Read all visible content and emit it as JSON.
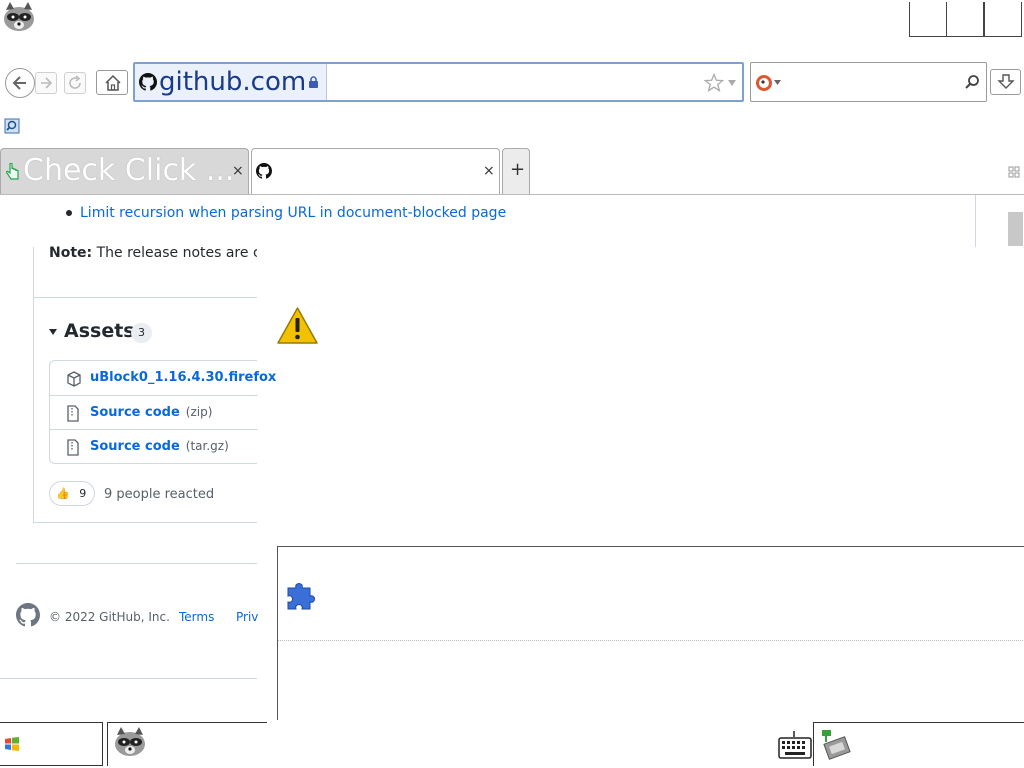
{
  "browser": {
    "address": {
      "domain": "github.com"
    },
    "tabs": [
      {
        "title": "Check Click ...",
        "close": "×"
      },
      {
        "title": "",
        "close": "×"
      }
    ],
    "new_tab": "+"
  },
  "page": {
    "bullet": "Limit recursion when parsing URL in document-blocked page",
    "note_label": "Note:",
    "note_text": "The release notes are cr",
    "assets": {
      "title": "Assets",
      "count": "3",
      "items": [
        {
          "name": "uBlock0_1.16.4.30.firefox",
          "ext": ""
        },
        {
          "name": "Source code",
          "ext": "(zip)"
        },
        {
          "name": "Source code",
          "ext": "(tar.gz)"
        }
      ]
    },
    "reactions": {
      "emoji": "👍",
      "count": "9",
      "text": "9 people reacted"
    },
    "footer": {
      "copyright": "© 2022 GitHub, Inc.",
      "terms": "Terms",
      "privacy": "Priv"
    }
  },
  "colors": {
    "link": "#0969da",
    "url_text": "#1a3a8a",
    "plugin_blue": "#3a6fd8",
    "warning": "#f2c200"
  },
  "icons": [
    "raccoon-app-icon",
    "back-arrow-icon",
    "forward-arrow-icon",
    "reload-icon",
    "home-icon",
    "github-favicon",
    "lock-icon",
    "star-icon",
    "dropdown-icon",
    "duckduckgo-icon",
    "search-icon",
    "download-icon",
    "zoom-page-icon",
    "hand-cursor-icon",
    "tab-list-icon",
    "warning-icon",
    "puzzle-plugin-icon",
    "package-icon",
    "file-zip-icon",
    "github-logo-icon",
    "windows-flag-icon",
    "keyboard-icon",
    "network-icon"
  ]
}
